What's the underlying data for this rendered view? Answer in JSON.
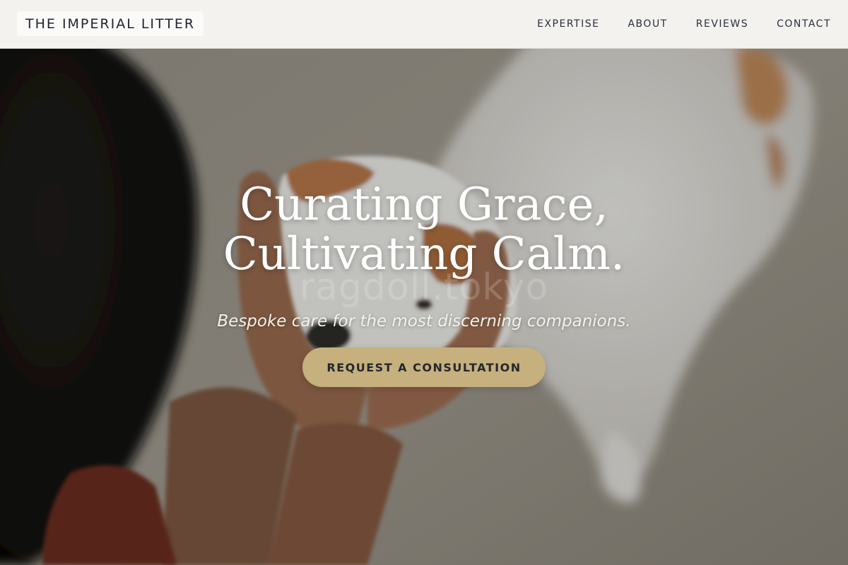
{
  "header": {
    "logo_text": "THE IMPERIAL LITTER",
    "nav": [
      {
        "label": "EXPERTISE"
      },
      {
        "label": "ABOUT"
      },
      {
        "label": "REVIEWS"
      },
      {
        "label": "CONTACT"
      }
    ]
  },
  "hero": {
    "headline_line1": "Curating Grace,",
    "headline_line2": "Cultivating Calm.",
    "subheadline": "Bespoke care for the most discerning companions.",
    "watermark": "ragdoll.tokyo",
    "cta_label": "REQUEST A CONSULTATION",
    "image_subject": "hands cradling a white and tan dog's head"
  },
  "colors": {
    "header_bg": "#f3f2ef",
    "text_dark": "#1f2430",
    "cta_bg": "#c5b07e",
    "hero_text": "#ffffff"
  }
}
